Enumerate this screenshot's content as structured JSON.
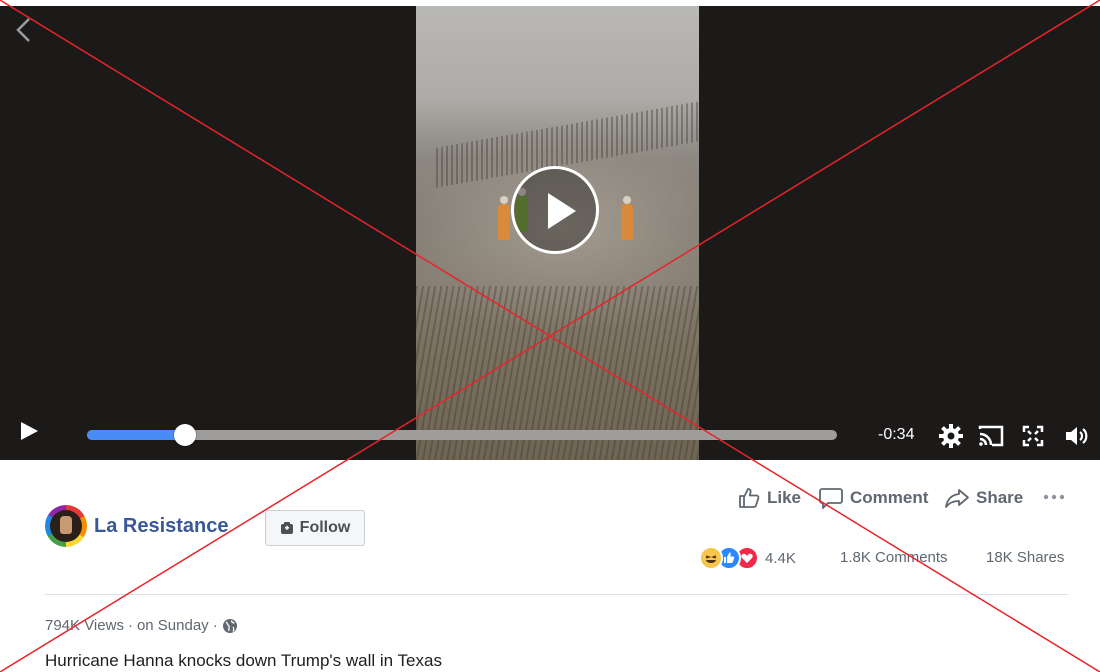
{
  "video": {
    "time_remaining": "-0:34",
    "progress_fraction": 0.13
  },
  "post": {
    "page_name": "La Resistance",
    "follow_label": "Follow",
    "actions": {
      "like": "Like",
      "comment": "Comment",
      "share": "Share"
    },
    "reactions_count": "4.4K",
    "comments_count": "1.8K Comments",
    "shares_count": "18K Shares",
    "views": "794K Views",
    "date": "on Sunday",
    "separator": "·",
    "caption": "Hurricane Hanna knocks down Trump's wall in Texas"
  },
  "colors": {
    "link_blue": "#385898",
    "progress_blue": "#4a8cf7",
    "overlay_red": "#e8232a"
  },
  "icons": [
    "back-chevron-icon",
    "play-icon",
    "gear-icon",
    "cast-icon",
    "fullscreen-icon",
    "volume-icon",
    "thumbs-up-icon",
    "comment-bubble-icon",
    "share-arrow-icon",
    "more-dots-icon",
    "follow-icon",
    "globe-icon",
    "haha-reaction-icon",
    "like-reaction-icon",
    "love-reaction-icon"
  ]
}
